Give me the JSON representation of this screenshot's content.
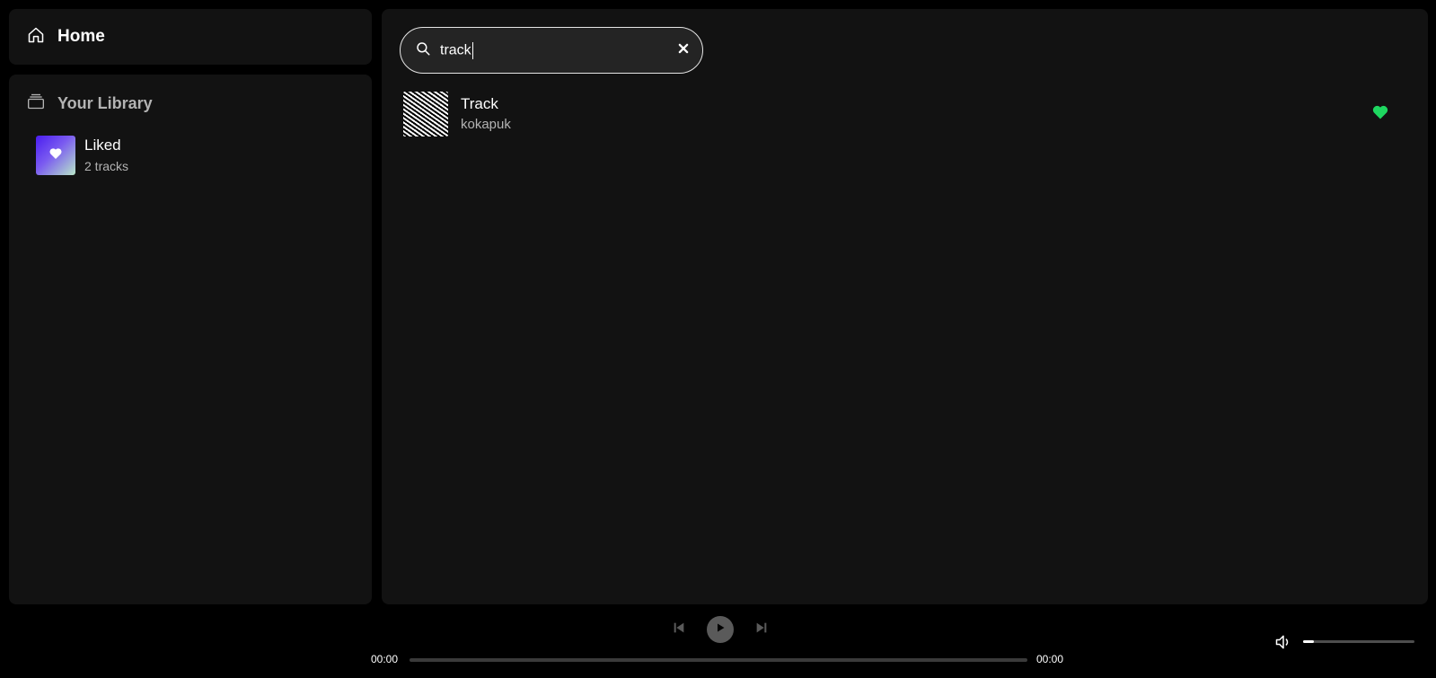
{
  "sidebar": {
    "home_label": "Home",
    "library_label": "Your Library",
    "items": [
      {
        "title": "Liked",
        "subtitle": "2 tracks",
        "icon": "heart-icon",
        "cover_gradient": [
          "#4a1df0",
          "#b8e6c9"
        ]
      }
    ]
  },
  "search": {
    "value": "track",
    "icon": "search-icon",
    "clear_icon": "close-icon"
  },
  "results": [
    {
      "title": "Track",
      "artist": "kokapuk",
      "liked": true,
      "heart_color": "#1ed760"
    }
  ],
  "player": {
    "current_time": "00:00",
    "total_time": "00:00",
    "progress": 0,
    "volume": 0.1
  },
  "colors": {
    "background": "#000000",
    "panel": "#121212",
    "accent": "#1ed760",
    "muted_text": "#b3b3b3"
  }
}
